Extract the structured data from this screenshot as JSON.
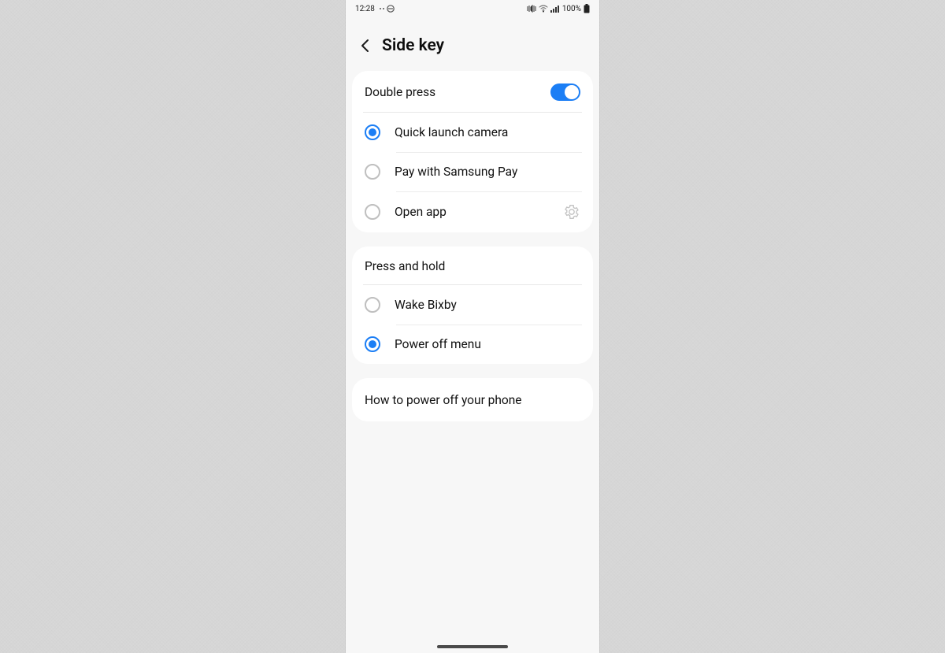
{
  "statusbar": {
    "time": "12:28",
    "battery_text": "100%"
  },
  "header": {
    "title": "Side key"
  },
  "section_double_press": {
    "title": "Double press",
    "toggle_on": true,
    "options": [
      {
        "label": "Quick launch camera",
        "selected": true
      },
      {
        "label": "Pay with Samsung Pay",
        "selected": false
      },
      {
        "label": "Open app",
        "selected": false,
        "has_gear": true
      }
    ]
  },
  "section_press_hold": {
    "title": "Press and hold",
    "options": [
      {
        "label": "Wake Bixby",
        "selected": false
      },
      {
        "label": "Power off menu",
        "selected": true
      }
    ]
  },
  "link_row": {
    "label": "How to power off your phone"
  }
}
